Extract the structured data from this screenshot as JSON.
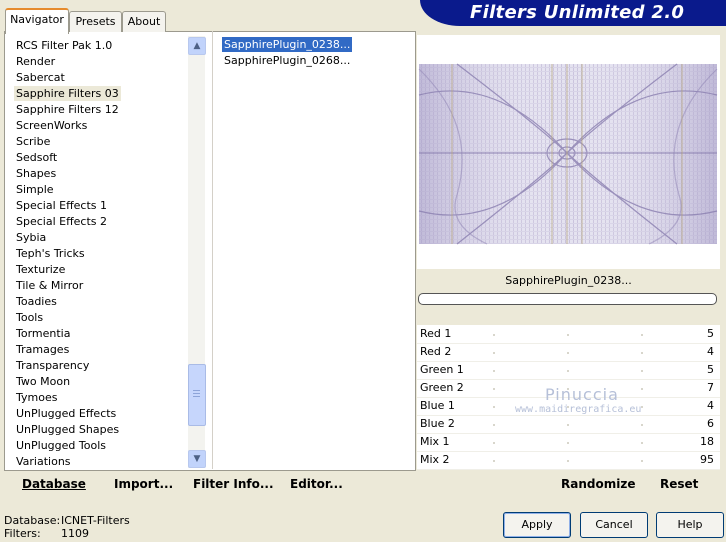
{
  "app": {
    "title": "Filters Unlimited 2.0"
  },
  "tabs": [
    {
      "label": "Navigator"
    },
    {
      "label": "Presets"
    },
    {
      "label": "About"
    }
  ],
  "categories": [
    "RCS Filter Pak 1.0",
    "Render",
    "Sabercat",
    "Sapphire Filters 03",
    "Sapphire Filters 12",
    "ScreenWorks",
    "Scribe",
    "Sedsoft",
    "Shapes",
    "Simple",
    "Special Effects 1",
    "Special Effects 2",
    "Sybia",
    "Teph's Tricks",
    "Texturize",
    "Tile & Mirror",
    "Toadies",
    "Tools",
    "Tormentia",
    "Tramages",
    "Transparency",
    "Two Moon",
    "Tymoes",
    "UnPlugged Effects",
    "UnPlugged Shapes",
    "UnPlugged Tools",
    "Variations"
  ],
  "selected_category": "Sapphire Filters 03",
  "filters": [
    "SapphirePlugin_0238...",
    "SapphirePlugin_0268..."
  ],
  "selected_filter": "SapphirePlugin_0238...",
  "preview": {
    "name": "SapphirePlugin_0238..."
  },
  "params": [
    {
      "label": "Red 1",
      "value": "5"
    },
    {
      "label": "Red 2",
      "value": "4"
    },
    {
      "label": "Green 1",
      "value": "5"
    },
    {
      "label": "Green 2",
      "value": "7"
    },
    {
      "label": "Blue 1",
      "value": "4"
    },
    {
      "label": "Blue 2",
      "value": "6"
    },
    {
      "label": "Mix 1",
      "value": "18"
    },
    {
      "label": "Mix 2",
      "value": "95"
    }
  ],
  "watermark": {
    "line1": "Pinuccia",
    "line2": "www.maidiregrafica.eu"
  },
  "toolbar": {
    "database": "Database",
    "import": "Import...",
    "filter_info": "Filter Info...",
    "editor": "Editor...",
    "randomize": "Randomize",
    "reset": "Reset"
  },
  "info": {
    "database_label": "Database:",
    "database_value": "ICNET-Filters",
    "filters_label": "Filters:",
    "filters_value": "1109"
  },
  "buttons": {
    "apply": "Apply",
    "cancel": "Cancel",
    "help": "Help"
  },
  "colors": {
    "banner": "#0a1a8c",
    "selection": "#316ac5",
    "tab_accent": "#e68b2c"
  }
}
